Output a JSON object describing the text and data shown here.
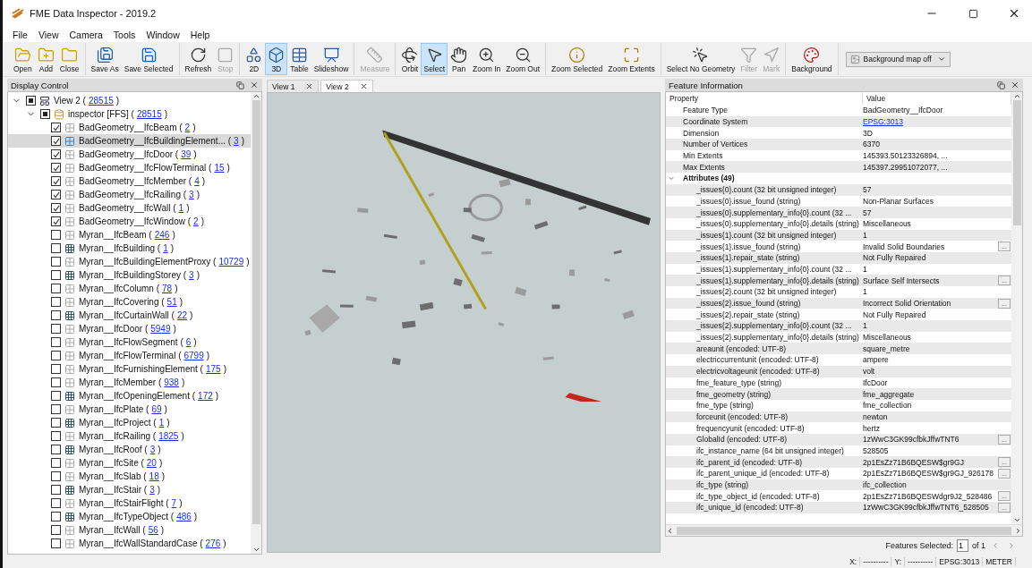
{
  "window": {
    "title": "FME Data Inspector - 2019.2"
  },
  "menu": [
    "File",
    "View",
    "Camera",
    "Tools",
    "Window",
    "Help"
  ],
  "toolbar": [
    [
      {
        "label": "Open",
        "selected": false,
        "disabled": false
      },
      {
        "label": "Add",
        "selected": false,
        "disabled": false
      },
      {
        "label": "Close",
        "selected": false,
        "disabled": false
      }
    ],
    [
      {
        "label": "Save As",
        "selected": false,
        "disabled": false
      },
      {
        "label": "Save Selected",
        "selected": false,
        "disabled": false
      }
    ],
    [
      {
        "label": "Refresh",
        "selected": false,
        "disabled": false
      },
      {
        "label": "Stop",
        "selected": false,
        "disabled": true
      }
    ],
    [
      {
        "label": "2D",
        "selected": false,
        "disabled": false
      },
      {
        "label": "3D",
        "selected": true,
        "disabled": false
      },
      {
        "label": "Table",
        "selected": false,
        "disabled": false
      },
      {
        "label": "Slideshow",
        "selected": false,
        "disabled": false
      }
    ],
    [
      {
        "label": "Measure",
        "selected": false,
        "disabled": true
      }
    ],
    [
      {
        "label": "Orbit",
        "selected": false,
        "disabled": false
      },
      {
        "label": "Select",
        "selected": true,
        "disabled": false
      },
      {
        "label": "Pan",
        "selected": false,
        "disabled": false
      },
      {
        "label": "Zoom In",
        "selected": false,
        "disabled": false
      },
      {
        "label": "Zoom Out",
        "selected": false,
        "disabled": false
      }
    ],
    [
      {
        "label": "Zoom Selected",
        "selected": false,
        "disabled": false
      },
      {
        "label": "Zoom Extents",
        "selected": false,
        "disabled": false
      }
    ],
    [
      {
        "label": "Select No Geometry",
        "selected": false,
        "disabled": false
      },
      {
        "label": "Filter",
        "selected": false,
        "disabled": true
      },
      {
        "label": "Mark",
        "selected": false,
        "disabled": true
      }
    ],
    [
      {
        "label": "Background",
        "selected": false,
        "disabled": false
      }
    ]
  ],
  "background_select": {
    "value": "Background map off"
  },
  "display_control": {
    "title": "Display Control",
    "tree": [
      {
        "label": "View 2 (",
        "count": "28515",
        "tail": ")",
        "kind": "view",
        "partial": true,
        "expanded": true,
        "selected": false,
        "children": [
          {
            "label": "inspector [FFS] (",
            "count": "28515",
            "tail": ")",
            "kind": "database",
            "partial": true,
            "expanded": true,
            "selected": false,
            "children": [
              {
                "label": "BadGeometry__IfcBeam (",
                "count": "2",
                "tail": ")",
                "kind": "layer",
                "checked": true,
                "selected": false
              },
              {
                "label": "BadGeometry__IfcBuildingElement... (",
                "count": "3",
                "tail": ")",
                "kind": "layer",
                "checked": true,
                "selected": true
              },
              {
                "label": "BadGeometry__IfcDoor (",
                "count": "39",
                "tail": ")",
                "kind": "layer",
                "checked": true,
                "selected": false
              },
              {
                "label": "BadGeometry__IfcFlowTerminal (",
                "count": "15",
                "tail": ")",
                "kind": "layer",
                "checked": true,
                "selected": false
              },
              {
                "label": "BadGeometry__IfcMember (",
                "count": "4",
                "tail": ")",
                "kind": "layer",
                "checked": true,
                "selected": false
              },
              {
                "label": "BadGeometry__IfcRailing (",
                "count": "3",
                "tail": ")",
                "kind": "layer",
                "checked": true,
                "selected": false
              },
              {
                "label": "BadGeometry__IfcWall (",
                "count": "1",
                "tail": ")",
                "kind": "layer",
                "checked": true,
                "selected": false
              },
              {
                "label": "BadGeometry__IfcWindow (",
                "count": "2",
                "tail": ")",
                "kind": "layer",
                "checked": true,
                "selected": false
              },
              {
                "label": "Myran__IfcBeam (",
                "count": "246",
                "tail": ")",
                "kind": "layer",
                "checked": false,
                "selected": false
              },
              {
                "label": "Myran__IfcBuilding (",
                "count": "1",
                "tail": ")",
                "kind": "table",
                "checked": false,
                "selected": false
              },
              {
                "label": "Myran__IfcBuildingElementProxy (",
                "count": "10729",
                "tail": ")",
                "kind": "layer",
                "checked": false,
                "selected": false
              },
              {
                "label": "Myran__IfcBuildingStorey (",
                "count": "3",
                "tail": ")",
                "kind": "table",
                "checked": false,
                "selected": false
              },
              {
                "label": "Myran__IfcColumn (",
                "count": "78",
                "tail": ")",
                "kind": "layer",
                "checked": false,
                "selected": false
              },
              {
                "label": "Myran__IfcCovering (",
                "count": "51",
                "tail": ")",
                "kind": "layer",
                "checked": false,
                "selected": false
              },
              {
                "label": "Myran__IfcCurtainWall (",
                "count": "22",
                "tail": ")",
                "kind": "table",
                "checked": false,
                "selected": false
              },
              {
                "label": "Myran__IfcDoor (",
                "count": "5949",
                "tail": ")",
                "kind": "layer",
                "checked": false,
                "selected": false
              },
              {
                "label": "Myran__IfcFlowSegment (",
                "count": "6",
                "tail": ")",
                "kind": "layer",
                "checked": false,
                "selected": false
              },
              {
                "label": "Myran__IfcFlowTerminal (",
                "count": "6799",
                "tail": ")",
                "kind": "layer",
                "checked": false,
                "selected": false
              },
              {
                "label": "Myran__IfcFurnishingElement (",
                "count": "175",
                "tail": ")",
                "kind": "layer",
                "checked": false,
                "selected": false
              },
              {
                "label": "Myran__IfcMember (",
                "count": "938",
                "tail": ")",
                "kind": "layer",
                "checked": false,
                "selected": false
              },
              {
                "label": "Myran__IfcOpeningElement (",
                "count": "172",
                "tail": ")",
                "kind": "table",
                "checked": false,
                "selected": false
              },
              {
                "label": "Myran__IfcPlate (",
                "count": "69",
                "tail": ")",
                "kind": "layer",
                "checked": false,
                "selected": false
              },
              {
                "label": "Myran__IfcProject (",
                "count": "1",
                "tail": ")",
                "kind": "table",
                "checked": false,
                "selected": false
              },
              {
                "label": "Myran__IfcRailing (",
                "count": "1825",
                "tail": ")",
                "kind": "layer",
                "checked": false,
                "selected": false
              },
              {
                "label": "Myran__IfcRoof (",
                "count": "3",
                "tail": ")",
                "kind": "table",
                "checked": false,
                "selected": false
              },
              {
                "label": "Myran__IfcSite (",
                "count": "20",
                "tail": ")",
                "kind": "layer",
                "checked": false,
                "selected": false
              },
              {
                "label": "Myran__IfcSlab (",
                "count": "18",
                "tail": ")",
                "kind": "layer",
                "checked": false,
                "selected": false
              },
              {
                "label": "Myran__IfcStair (",
                "count": "3",
                "tail": ")",
                "kind": "table",
                "checked": false,
                "selected": false
              },
              {
                "label": "Myran__IfcStairFlight (",
                "count": "7",
                "tail": ")",
                "kind": "layer",
                "checked": false,
                "selected": false
              },
              {
                "label": "Myran__IfcTypeObject (",
                "count": "486",
                "tail": ")",
                "kind": "table",
                "checked": false,
                "selected": false
              },
              {
                "label": "Myran__IfcWall (",
                "count": "56",
                "tail": ")",
                "kind": "layer",
                "checked": false,
                "selected": false
              },
              {
                "label": "Myran__IfcWallStandardCase (",
                "count": "276",
                "tail": ")",
                "kind": "layer",
                "checked": false,
                "selected": false
              }
            ]
          }
        ]
      }
    ]
  },
  "view_tabs": [
    {
      "label": "View 1",
      "selected": false
    },
    {
      "label": "View 2",
      "selected": true
    }
  ],
  "feature_information": {
    "title": "Feature Information",
    "columns": [
      "Property",
      "Value"
    ],
    "rows": [
      {
        "property": "Feature Type",
        "value": "BadGeometry__IfcDoor",
        "link": false
      },
      {
        "property": "Coordinate System",
        "value": "EPSG:3013",
        "link": true
      },
      {
        "property": "Dimension",
        "value": "3D",
        "link": false
      },
      {
        "property": "Number of Vertices",
        "value": "6370",
        "link": false
      },
      {
        "property": "Min Extents",
        "value": "145393.50123326894, ...",
        "link": false
      },
      {
        "property": "Max Extents",
        "value": "145397.29951072077, ...",
        "link": false
      }
    ],
    "attributes": {
      "label": "Attributes (49)",
      "expanded": true,
      "rows": [
        {
          "property": "_issues{0}.count (32 bit unsigned integer)",
          "value": "57",
          "more": false
        },
        {
          "property": "_issues{0}.issue_found (string)",
          "value": "Non-Planar Surfaces",
          "more": false
        },
        {
          "property": "_issues{0}.supplementary_info{0}.count (32 ...",
          "value": "57",
          "more": false
        },
        {
          "property": "_issues{0}.supplementary_info{0}.details (string)",
          "value": "Miscellaneous",
          "more": false
        },
        {
          "property": "_issues{1}.count (32 bit unsigned integer)",
          "value": "1",
          "more": false
        },
        {
          "property": "_issues{1}.issue_found (string)",
          "value": "Invalid Solid Boundaries",
          "more": true
        },
        {
          "property": "_issues{1}.repair_state (string)",
          "value": "Not Fully Repaired",
          "more": false
        },
        {
          "property": "_issues{1}.supplementary_info{0}.count (32 ...",
          "value": "1",
          "more": false
        },
        {
          "property": "_issues{1}.supplementary_info{0}.details (string)",
          "value": "Surface Self Intersects",
          "more": true
        },
        {
          "property": "_issues{2}.count (32 bit unsigned integer)",
          "value": "1",
          "more": false
        },
        {
          "property": "_issues{2}.issue_found (string)",
          "value": "Incorrect Solid Orientation",
          "more": true
        },
        {
          "property": "_issues{2}.repair_state (string)",
          "value": "Not Fully Repaired",
          "more": false
        },
        {
          "property": "_issues{2}.supplementary_info{0}.count (32 ...",
          "value": "1",
          "more": false
        },
        {
          "property": "_issues{2}.supplementary_info{0}.details (string)",
          "value": "Miscellaneous",
          "more": false
        },
        {
          "property": "areaunit (encoded: UTF-8)",
          "value": "square_metre",
          "more": false
        },
        {
          "property": "electriccurrentunit (encoded: UTF-8)",
          "value": "ampere",
          "more": false
        },
        {
          "property": "electricvoltageunit (encoded: UTF-8)",
          "value": "volt",
          "more": false
        },
        {
          "property": "fme_feature_type (string)",
          "value": "IfcDoor",
          "more": false
        },
        {
          "property": "fme_geometry (string)",
          "value": "fme_aggregate",
          "more": false
        },
        {
          "property": "fme_type (string)",
          "value": "fme_collection",
          "more": false
        },
        {
          "property": "forceunit (encoded: UTF-8)",
          "value": "newton",
          "more": false
        },
        {
          "property": "frequencyunit (encoded: UTF-8)",
          "value": "hertz",
          "more": false
        },
        {
          "property": "GlobalId (encoded: UTF-8)",
          "value": "1zWwC3GK99cfbkJffwTNT6",
          "more": true
        },
        {
          "property": "ifc_instance_name (64 bit unsigned integer)",
          "value": "528505",
          "more": false
        },
        {
          "property": "ifc_parent_id (encoded: UTF-8)",
          "value": "2p1EsZz71B6BQESW$gr9GJ",
          "more": true
        },
        {
          "property": "ifc_parent_unique_id (encoded: UTF-8)",
          "value": "2p1EsZz71B6BQESW$gr9GJ_926178",
          "more": true
        },
        {
          "property": "ifc_type (string)",
          "value": "ifc_collection",
          "more": false
        },
        {
          "property": "ifc_type_object_id (encoded: UTF-8)",
          "value": "2p1EsZz71B6BQESWdgr9J2_528486",
          "more": true
        },
        {
          "property": "ifc_unique_id (encoded: UTF-8)",
          "value": "1zWwC3GK99cfbkJffwTNT6_528505",
          "more": true
        }
      ]
    },
    "more_button": "...",
    "features_selected": {
      "label": "Features Selected:",
      "value": "1",
      "of": "of 1"
    }
  },
  "status_bar": {
    "x_label": "X:",
    "x_value": "----------",
    "y_label": "Y:",
    "y_value": "----------",
    "crs": "EPSG:3013",
    "units": "METER"
  }
}
